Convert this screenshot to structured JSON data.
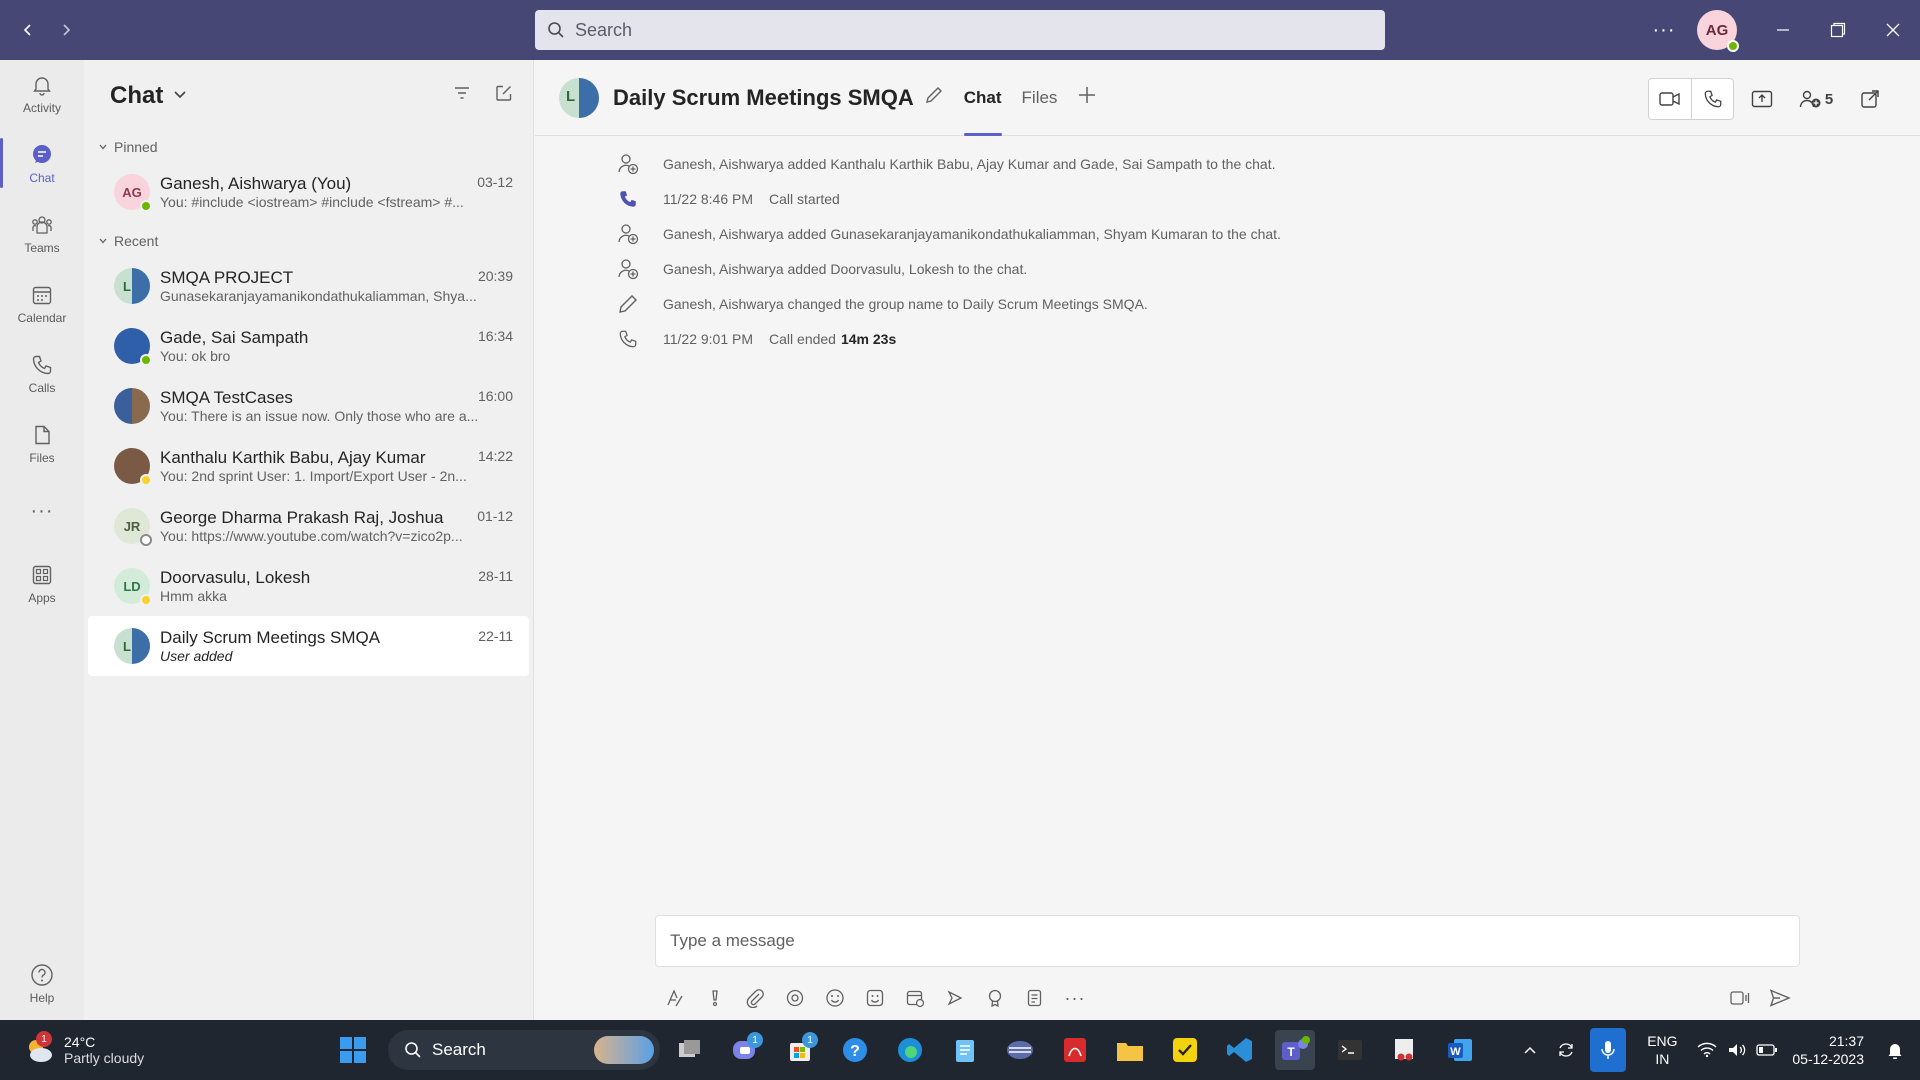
{
  "search": {
    "placeholder": "Search"
  },
  "top_avatar": "AG",
  "rail": [
    {
      "label": "Activity",
      "icon": "bell-icon"
    },
    {
      "label": "Chat",
      "icon": "chat-icon"
    },
    {
      "label": "Teams",
      "icon": "teams-icon"
    },
    {
      "label": "Calendar",
      "icon": "calendar-icon"
    },
    {
      "label": "Calls",
      "icon": "phone-icon"
    },
    {
      "label": "Files",
      "icon": "file-icon"
    },
    {
      "label": "Apps",
      "icon": "apps-icon"
    },
    {
      "label": "Help",
      "icon": "help-icon"
    }
  ],
  "chat_list": {
    "title": "Chat",
    "pinned_label": "Pinned",
    "recent_label": "Recent",
    "pinned": [
      {
        "name": "Ganesh, Aishwarya (You)",
        "preview": "You: #include <iostream> #include <fstream> #...",
        "time": "03-12",
        "initials": "AG"
      }
    ],
    "recent": [
      {
        "name": "SMQA PROJECT",
        "preview": "Gunasekaranjayamanikondathukaliamman, Shya...",
        "time": "20:39",
        "initials": "L"
      },
      {
        "name": "Gade, Sai Sampath",
        "preview": "You: ok bro",
        "time": "16:34",
        "initials": ""
      },
      {
        "name": "SMQA TestCases",
        "preview": "You: There is an issue now. Only those who are a...",
        "time": "16:00",
        "initials": ""
      },
      {
        "name": "Kanthalu Karthik Babu, Ajay Kumar",
        "preview": "You: 2nd sprint User: 1. Import/Export User - 2n...",
        "time": "14:22",
        "initials": ""
      },
      {
        "name": "George Dharma Prakash Raj, Joshua",
        "preview": "You: https://www.youtube.com/watch?v=zico2p...",
        "time": "01-12",
        "initials": "JR"
      },
      {
        "name": "Doorvasulu, Lokesh",
        "preview": "Hmm akka",
        "time": "28-11",
        "initials": "LD"
      },
      {
        "name": "Daily Scrum Meetings SMQA",
        "preview": "User added",
        "time": "22-11",
        "initials": "L"
      }
    ]
  },
  "main": {
    "title": "Daily Scrum Meetings SMQA",
    "avatar_initials": "L",
    "tabs": [
      "Chat",
      "Files"
    ],
    "participants_count": "5",
    "events": [
      {
        "icon": "person-add-icon",
        "time": "",
        "text": "Ganesh, Aishwarya added Kanthalu Karthik Babu, Ajay Kumar and Gade, Sai Sampath to the chat.",
        "bold": ""
      },
      {
        "icon": "phone-filled-icon",
        "time": "11/22 8:46 PM",
        "text": "Call started",
        "bold": ""
      },
      {
        "icon": "person-add-icon",
        "time": "",
        "text": "Ganesh, Aishwarya added Gunasekaranjayamanikondathukaliamman, Shyam Kumaran to the chat.",
        "bold": ""
      },
      {
        "icon": "person-add-icon",
        "time": "",
        "text": "Ganesh, Aishwarya added Doorvasulu, Lokesh to the chat.",
        "bold": ""
      },
      {
        "icon": "pencil-icon",
        "time": "",
        "text": "Ganesh, Aishwarya changed the group name to Daily Scrum Meetings SMQA.",
        "bold": ""
      },
      {
        "icon": "phone-outline-icon",
        "time": "11/22 9:01 PM",
        "text": "Call ended",
        "bold": "14m 23s"
      }
    ],
    "composer_placeholder": "Type a message"
  },
  "taskbar": {
    "temp": "24°C",
    "weather": "Partly cloudy",
    "weather_badge": "1",
    "search_label": "Search",
    "lang_top": "ENG",
    "lang_bottom": "IN",
    "time": "21:37",
    "date": "05-12-2023",
    "badge_1": "1",
    "badge_2": "1"
  }
}
